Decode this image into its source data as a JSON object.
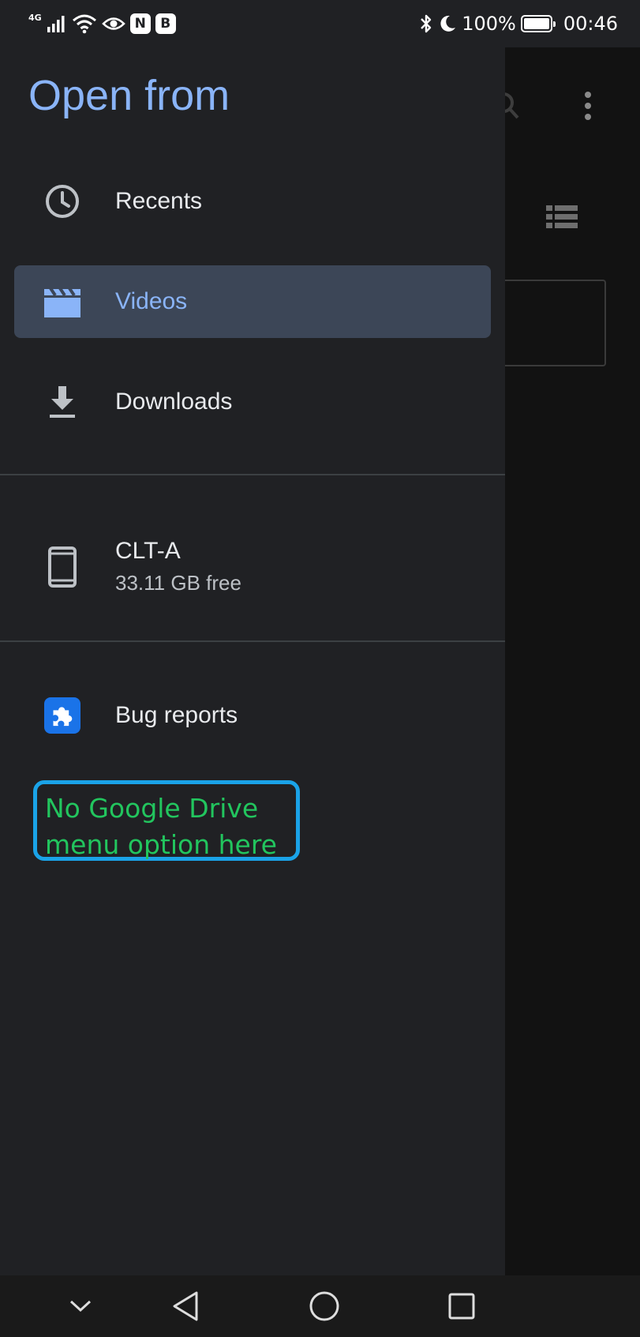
{
  "status_bar": {
    "network": "4G",
    "nfc_badge": "N",
    "b_badge": "B",
    "battery": "100%",
    "time": "00:46"
  },
  "drawer": {
    "title": "Open from",
    "items": [
      {
        "label": "Recents",
        "icon": "clock-icon"
      },
      {
        "label": "Videos",
        "icon": "video-clapper-icon",
        "selected": true
      },
      {
        "label": "Downloads",
        "icon": "download-icon"
      }
    ],
    "storage": {
      "label": "CLT-A",
      "sub": "33.11 GB free",
      "icon": "phone-icon"
    },
    "apps": [
      {
        "label": "Bug reports",
        "icon": "puzzle-icon"
      }
    ]
  },
  "annotation": {
    "line1": "No Google Drive",
    "line2": "menu option here"
  },
  "colors": {
    "accent": "#8ab4f8",
    "selected_bg": "#3c4657",
    "annotation_text": "#22c55e",
    "annotation_border": "#1aa3e8"
  }
}
